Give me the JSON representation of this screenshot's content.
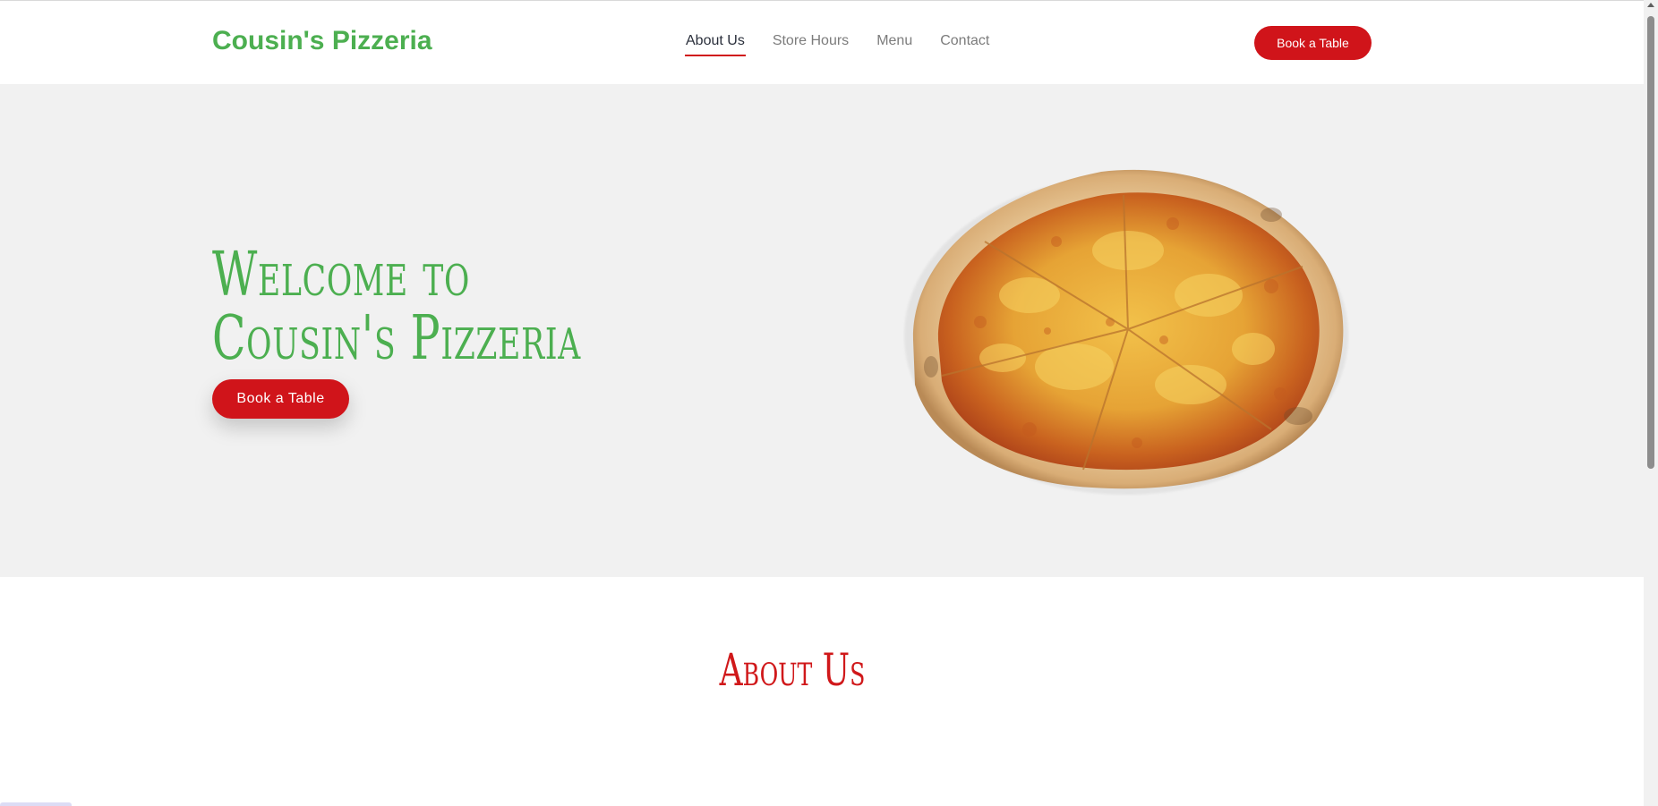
{
  "header": {
    "logo": "Cousin's Pizzeria",
    "nav": [
      {
        "label": "About Us",
        "active": true
      },
      {
        "label": "Store Hours",
        "active": false
      },
      {
        "label": "Menu",
        "active": false
      },
      {
        "label": "Contact",
        "active": false
      }
    ],
    "cta_label": "Book a Table"
  },
  "hero": {
    "title_line1": "Welcome to",
    "title_line2": "Cousin's Pizzeria",
    "cta_label": "Book a Table",
    "image_icon": "pizza-image"
  },
  "about": {
    "heading": "About Us"
  },
  "colors": {
    "brand_green": "#4caf50",
    "accent_red": "#d0141a",
    "hero_bg": "#f1f1f1"
  }
}
